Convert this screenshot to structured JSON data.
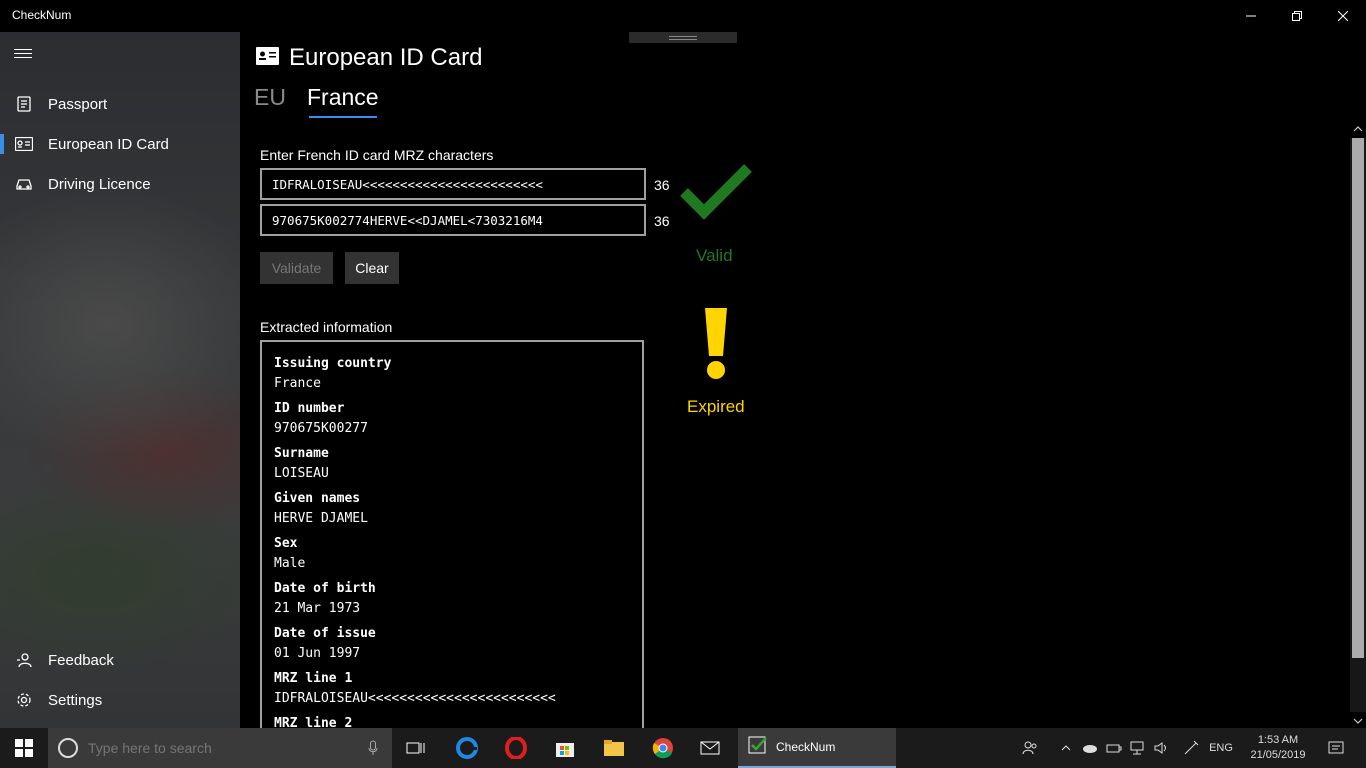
{
  "window": {
    "title": "CheckNum"
  },
  "sidebar": {
    "items": [
      {
        "label": "Passport",
        "icon": "passport-icon"
      },
      {
        "label": "European ID Card",
        "icon": "id-card-icon"
      },
      {
        "label": "Driving Licence",
        "icon": "car-icon"
      }
    ],
    "footer": [
      {
        "label": "Feedback",
        "icon": "feedback-icon"
      },
      {
        "label": "Settings",
        "icon": "gear-icon"
      }
    ],
    "accent": "#3b8ee8"
  },
  "page": {
    "title": "European ID Card",
    "tabs": [
      {
        "label": "EU"
      },
      {
        "label": "France"
      }
    ],
    "selected_tab": "France"
  },
  "mrz": {
    "prompt": "Enter French ID card MRZ characters",
    "line1": "IDFRALOISEAU<<<<<<<<<<<<<<<<<<<<<<<<",
    "line2": "970675K002774HERVE<<DJAMEL<7303216M4",
    "line1_count": "36",
    "line2_count": "36"
  },
  "buttons": {
    "validate": "Validate",
    "clear": "Clear"
  },
  "status": {
    "valid_label": "Valid",
    "valid_color": "#1f7a1f",
    "expired_label": "Expired",
    "expired_color": "#ffd400"
  },
  "extracted": {
    "heading": "Extracted information",
    "fields": [
      {
        "key": "Issuing country",
        "value": "France"
      },
      {
        "key": "ID number",
        "value": "970675K00277"
      },
      {
        "key": "Surname",
        "value": "LOISEAU"
      },
      {
        "key": "Given names",
        "value": "HERVE DJAMEL"
      },
      {
        "key": "Sex",
        "value": "Male"
      },
      {
        "key": "Date of birth",
        "value": "21 Mar 1973"
      },
      {
        "key": "Date of issue",
        "value": "01 Jun 1997"
      },
      {
        "key": "MRZ line 1",
        "value": "IDFRALOISEAU<<<<<<<<<<<<<<<<<<<<<<<<"
      },
      {
        "key": "MRZ line 2",
        "value": ""
      }
    ]
  },
  "taskbar": {
    "search_placeholder": "Type here to search",
    "active_app": "CheckNum",
    "language": "ENG",
    "time": "1:53 AM",
    "date": "21/05/2019"
  }
}
